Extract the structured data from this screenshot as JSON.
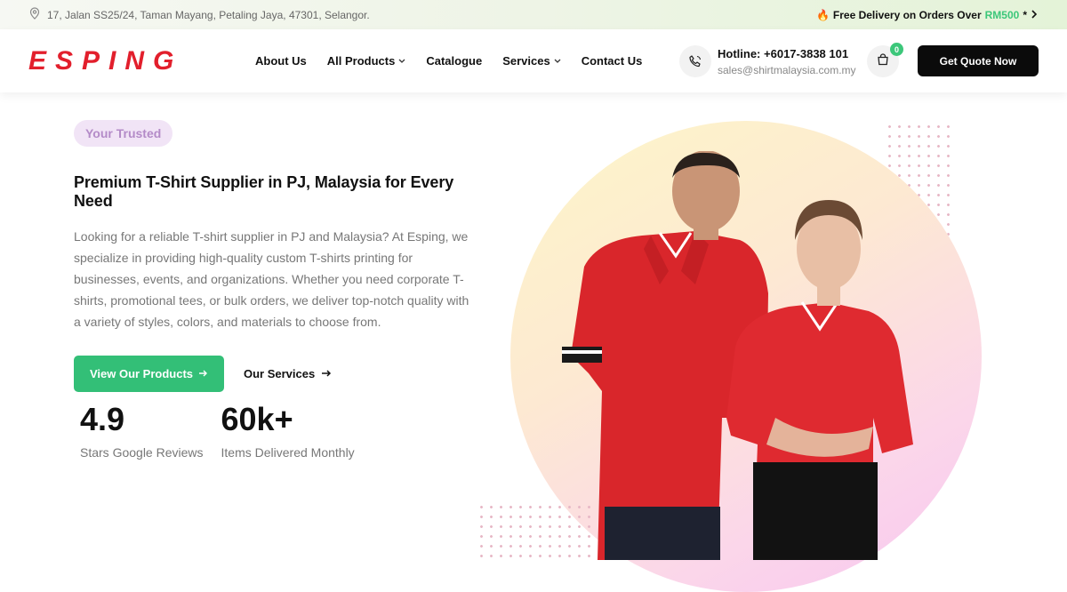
{
  "topbar": {
    "address": "17, Jalan SS25/24, Taman Mayang, Petaling Jaya, 47301, Selangor.",
    "promo_prefix": "Free Delivery on Orders Over",
    "promo_amount": "RM500",
    "promo_suffix": "*",
    "promo_icon": "fire-icon"
  },
  "header": {
    "logo": "ESPING",
    "nav": [
      {
        "label": "About Us",
        "dropdown": false
      },
      {
        "label": "All Products",
        "dropdown": true
      },
      {
        "label": "Catalogue",
        "dropdown": false
      },
      {
        "label": "Services",
        "dropdown": true
      },
      {
        "label": "Contact Us",
        "dropdown": false
      }
    ],
    "hotline_label": "Hotline:",
    "hotline_number": "+6017-3838 101",
    "email": "sales@shirtmalaysia.com.my",
    "cart_count": "0",
    "quote_button": "Get Quote Now"
  },
  "hero": {
    "badge": "Your Trusted",
    "title": "Premium T-Shirt Supplier in PJ, Malaysia for Every Need",
    "description": "Looking for a reliable T-shirt supplier in PJ and Malaysia? At Esping, we specialize in providing high-quality custom T-shirts printing for businesses, events, and organizations. Whether you need corporate T-shirts, promotional tees, or bulk orders, we deliver top-notch quality with a variety of styles, colors, and materials to choose from.",
    "primary_cta": "View Our Products",
    "secondary_cta": "Our Services"
  },
  "stats": [
    {
      "value": "4.9",
      "label": "Stars Google Reviews"
    },
    {
      "value": "60k+",
      "label": "Items Delivered Monthly"
    }
  ],
  "colors": {
    "brand_red": "#e21f2c",
    "accent_green": "#33bf77",
    "badge_bg": "#f1e4f6",
    "badge_text": "#b48bc8"
  }
}
